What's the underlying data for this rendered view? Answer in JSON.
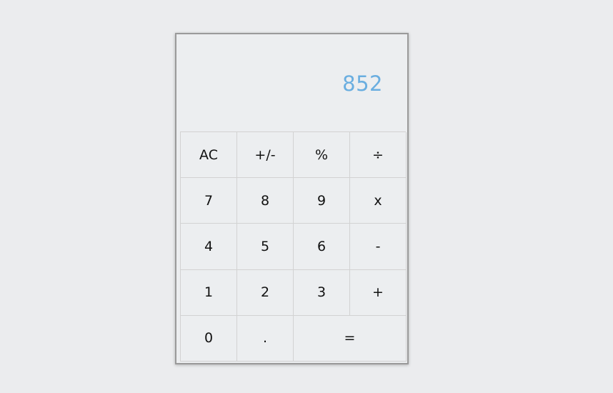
{
  "display": {
    "value": "852",
    "color": "#6aaee0"
  },
  "keys": {
    "row1": [
      "AC",
      "+/-",
      "%",
      "÷"
    ],
    "row2": [
      "7",
      "8",
      "9",
      "x"
    ],
    "row3": [
      "4",
      "5",
      "6",
      "-"
    ],
    "row4": [
      "1",
      "2",
      "3",
      "+"
    ],
    "row5": [
      "0",
      ".",
      "="
    ]
  }
}
